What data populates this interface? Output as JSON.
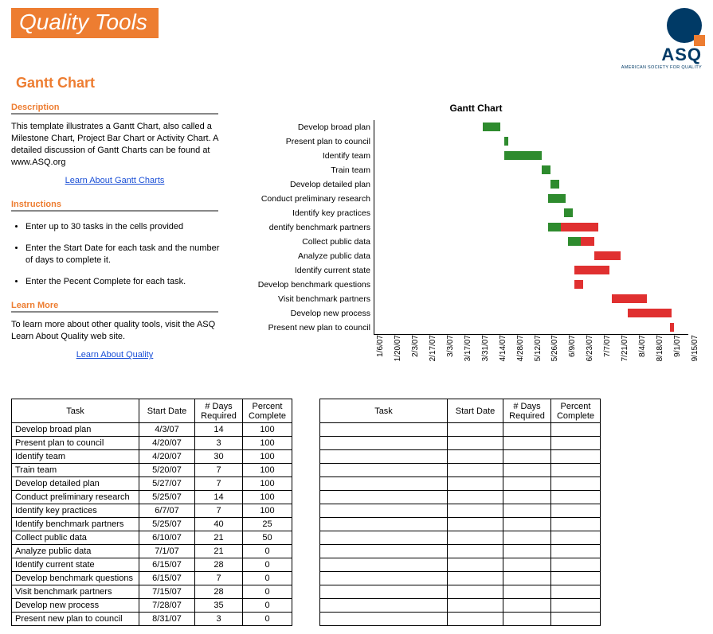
{
  "header": {
    "title": "Quality Tools",
    "subtitle": "Gantt Chart",
    "logo_text": "ASQ",
    "logo_sub": "AMERICAN SOCIETY FOR QUALITY"
  },
  "sections": {
    "description_head": "Description",
    "description_text": "This template illustrates a Gantt Chart, also called a Milestone Chart, Project Bar Chart or Activity Chart.  A detailed discussion of Gantt Charts can be found at www.ASQ.org",
    "link_gantt": "Learn About Gantt Charts",
    "instructions_head": "Instructions",
    "instructions": [
      "Enter up to 30 tasks in the cells provided",
      "Enter the Start Date for each task and the number of days to complete it.",
      "Enter the Pecent Complete for each task."
    ],
    "learn_head": "Learn More",
    "learn_text": "To learn more about other quality tools, visit the ASQ Learn About Quality web site.",
    "link_quality": "Learn About Quality"
  },
  "tables": {
    "headers": {
      "task": "Task",
      "start": "Start Date",
      "days": "# Days Required",
      "pct": "Percent Complete"
    },
    "rows": [
      {
        "task": "Develop broad plan",
        "start": "4/3/07",
        "days": "14",
        "pct": "100"
      },
      {
        "task": "Present plan to council",
        "start": "4/20/07",
        "days": "3",
        "pct": "100"
      },
      {
        "task": "Identify team",
        "start": "4/20/07",
        "days": "30",
        "pct": "100"
      },
      {
        "task": "Train team",
        "start": "5/20/07",
        "days": "7",
        "pct": "100"
      },
      {
        "task": "Develop detailed plan",
        "start": "5/27/07",
        "days": "7",
        "pct": "100"
      },
      {
        "task": "Conduct preliminary research",
        "start": "5/25/07",
        "days": "14",
        "pct": "100"
      },
      {
        "task": "Identify key practices",
        "start": "6/7/07",
        "days": "7",
        "pct": "100"
      },
      {
        "task": "Identify benchmark partners",
        "start": "5/25/07",
        "days": "40",
        "pct": "25"
      },
      {
        "task": "Collect public data",
        "start": "6/10/07",
        "days": "21",
        "pct": "50"
      },
      {
        "task": "Analyze public data",
        "start": "7/1/07",
        "days": "21",
        "pct": "0"
      },
      {
        "task": "Identify current state",
        "start": "6/15/07",
        "days": "28",
        "pct": "0"
      },
      {
        "task": "Develop benchmark questions",
        "start": "6/15/07",
        "days": "7",
        "pct": "0"
      },
      {
        "task": "Visit benchmark partners",
        "start": "7/15/07",
        "days": "28",
        "pct": "0"
      },
      {
        "task": "Develop new process",
        "start": "7/28/07",
        "days": "35",
        "pct": "0"
      },
      {
        "task": "Present new plan to council",
        "start": "8/31/07",
        "days": "3",
        "pct": "0"
      }
    ],
    "blank_rows": 15
  },
  "chart_data": {
    "type": "bar",
    "title": "Gantt Chart",
    "orientation": "horizontal",
    "x_axis_type": "date",
    "x_ticks": [
      "1/6/07",
      "1/20/07",
      "2/3/07",
      "2/17/07",
      "3/3/07",
      "3/17/07",
      "3/31/07",
      "4/14/07",
      "4/28/07",
      "5/12/07",
      "5/26/07",
      "6/9/07",
      "6/23/07",
      "7/7/07",
      "7/21/07",
      "8/4/07",
      "8/18/07",
      "9/1/07",
      "9/15/07"
    ],
    "x_range_days": [
      0,
      252
    ],
    "categories": [
      "Develop broad plan",
      "Present plan to council",
      "Identify team",
      "Train team",
      "Develop detailed plan",
      "Conduct preliminary research",
      "Identify key practices",
      "dentify benchmark partners",
      "Collect public data",
      "Analyze public data",
      "Identify current state",
      "Develop benchmark questions",
      "Visit benchmark partners",
      "Develop new process",
      "Present new plan to council"
    ],
    "series": [
      {
        "name": "offset_days",
        "role": "invisible-stack",
        "values": [
          87,
          104,
          104,
          134,
          141,
          139,
          152,
          139,
          155,
          176,
          160,
          160,
          190,
          203,
          237
        ]
      },
      {
        "name": "days_complete",
        "color": "#2e8b2e",
        "values": [
          14,
          3,
          30,
          7,
          7,
          14,
          7,
          10,
          10.5,
          0,
          0,
          0,
          0,
          0,
          0
        ]
      },
      {
        "name": "days_remaining",
        "color": "#e03030",
        "values": [
          0,
          0,
          0,
          0,
          0,
          0,
          0,
          30,
          10.5,
          21,
          28,
          7,
          28,
          35,
          3
        ]
      }
    ],
    "xlabel": "",
    "ylabel": ""
  }
}
